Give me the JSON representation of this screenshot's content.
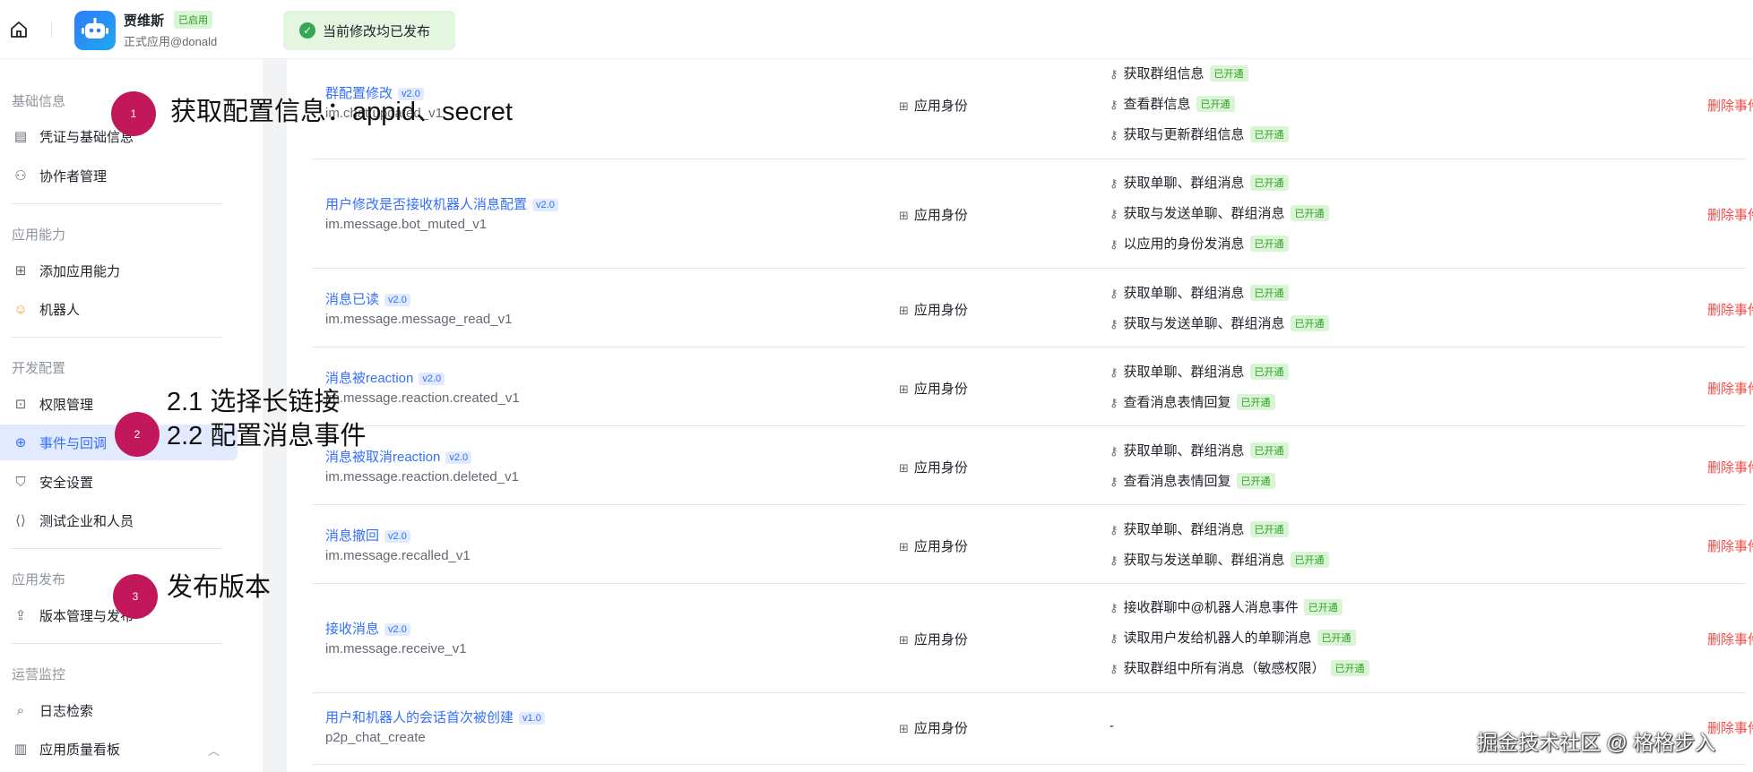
{
  "topbar": {
    "app_name": "贾维斯",
    "app_status": "已启用",
    "app_sub": "正式应用@donald",
    "notice": "当前修改均已发布"
  },
  "sidebar": {
    "sections": [
      {
        "title": "基础信息",
        "items": [
          {
            "label": "凭证与基础信息",
            "icon": "credential-icon"
          },
          {
            "label": "协作者管理",
            "icon": "collaborator-icon"
          }
        ]
      },
      {
        "title": "应用能力",
        "items": [
          {
            "label": "添加应用能力",
            "icon": "add-capability-icon"
          },
          {
            "label": "机器人",
            "icon": "robot-icon"
          }
        ]
      },
      {
        "title": "开发配置",
        "items": [
          {
            "label": "权限管理",
            "icon": "permission-icon"
          },
          {
            "label": "事件与回调",
            "icon": "event-icon"
          },
          {
            "label": "安全设置",
            "icon": "shield-icon"
          },
          {
            "label": "测试企业和人员",
            "icon": "test-icon"
          }
        ]
      },
      {
        "title": "应用发布",
        "items": [
          {
            "label": "版本管理与发布",
            "icon": "publish-icon"
          }
        ]
      },
      {
        "title": "运营监控",
        "items": [
          {
            "label": "日志检索",
            "icon": "log-search-icon"
          },
          {
            "label": "应用质量看板",
            "icon": "chart-icon"
          }
        ]
      }
    ],
    "active_item": "事件与回调"
  },
  "annotations": [
    {
      "num": "1",
      "text": "获取配置信息：appid、secret"
    },
    {
      "num": "2",
      "text_line1": "2.1 选择长链接",
      "text_line2": "2.2 配置消息事件"
    },
    {
      "num": "3",
      "text": "发布版本"
    }
  ],
  "events": [
    {
      "name": "群配置修改",
      "version": "v2.0",
      "id": "im.chat.updated_v1",
      "identity": "应用身份",
      "perms": [
        "获取群组信息",
        "查看群信息",
        "获取与更新群组信息"
      ],
      "action": "删除事件"
    },
    {
      "name": "用户修改是否接收机器人消息配置",
      "version": "v2.0",
      "id": "im.message.bot_muted_v1",
      "identity": "应用身份",
      "perms": [
        "获取单聊、群组消息",
        "获取与发送单聊、群组消息",
        "以应用的身份发消息"
      ],
      "action": "删除事件"
    },
    {
      "name": "消息已读",
      "version": "v2.0",
      "id": "im.message.message_read_v1",
      "identity": "应用身份",
      "perms": [
        "获取单聊、群组消息",
        "获取与发送单聊、群组消息"
      ],
      "action": "删除事件"
    },
    {
      "name": "消息被reaction",
      "version": "v2.0",
      "id": "im.message.reaction.created_v1",
      "identity": "应用身份",
      "perms": [
        "获取单聊、群组消息",
        "查看消息表情回复"
      ],
      "action": "删除事件"
    },
    {
      "name": "消息被取消reaction",
      "version": "v2.0",
      "id": "im.message.reaction.deleted_v1",
      "identity": "应用身份",
      "perms": [
        "获取单聊、群组消息",
        "查看消息表情回复"
      ],
      "action": "删除事件"
    },
    {
      "name": "消息撤回",
      "version": "v2.0",
      "id": "im.message.recalled_v1",
      "identity": "应用身份",
      "perms": [
        "获取单聊、群组消息",
        "获取与发送单聊、群组消息"
      ],
      "action": "删除事件"
    },
    {
      "name": "接收消息",
      "version": "v2.0",
      "id": "im.message.receive_v1",
      "identity": "应用身份",
      "perms": [
        "接收群聊中@机器人消息事件",
        "读取用户发给机器人的单聊消息",
        "获取群组中所有消息（敏感权限）"
      ],
      "action": "删除事件"
    },
    {
      "name": "用户和机器人的会话首次被创建",
      "version": "v1.0",
      "id": "p2p_chat_create",
      "identity": "应用身份",
      "perms": [],
      "no_perm": "-",
      "action": "删除事件"
    }
  ],
  "perm_status": "已开通",
  "watermark": "掘金技术社区 @ 格格步入"
}
